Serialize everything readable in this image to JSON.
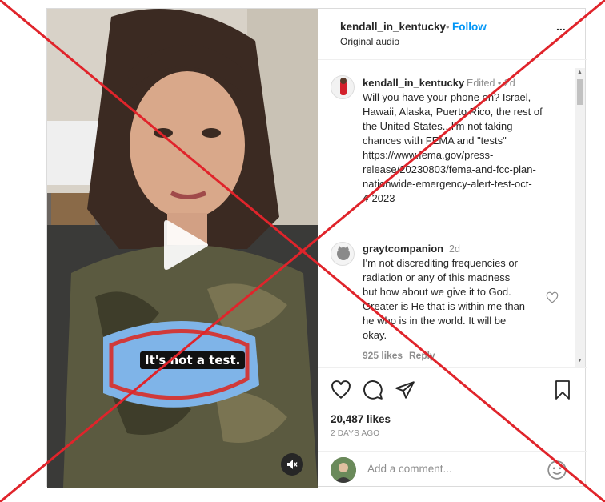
{
  "post": {
    "username": "kendall_in_kentucky",
    "separator": "•",
    "follow_label": "Follow",
    "audio_label": "Original audio",
    "more_label": "..."
  },
  "video": {
    "caption": "It's not a test.",
    "play_icon": "play-icon",
    "mute_icon": "speaker-muted-icon"
  },
  "comments": [
    {
      "username": "kendall_in_kentucky",
      "meta": "Edited • 2d",
      "lines": [
        "Will you have your phone on? Israel,",
        "Hawaii, Alaska, Puerto Rico, the rest of",
        "the United States...I'm not taking",
        "chances with FEMA and \"tests\"",
        "https://www.fema.gov/press-",
        "release/20230803/fema-and-fcc-plan-",
        "nationwide-emergency-alert-test-oct-",
        "4-2023"
      ]
    },
    {
      "username": "graytcompanion",
      "meta": "2d",
      "lines": [
        "I'm not discrediting frequencies or",
        "radiation or any of this madness",
        "but how about we give it to God.",
        "Greater is He that is within me than",
        "he who is in the world. It will be",
        "okay."
      ],
      "likes": "925 likes",
      "reply_label": "Reply"
    }
  ],
  "actions": {
    "likes": "20,487 likes",
    "time_ago": "2 DAYS AGO"
  },
  "add_comment": {
    "placeholder": "Add a comment..."
  },
  "colors": {
    "accent": "#0095f6",
    "cross": "#e0242b",
    "muted": "#8e8e8e"
  }
}
